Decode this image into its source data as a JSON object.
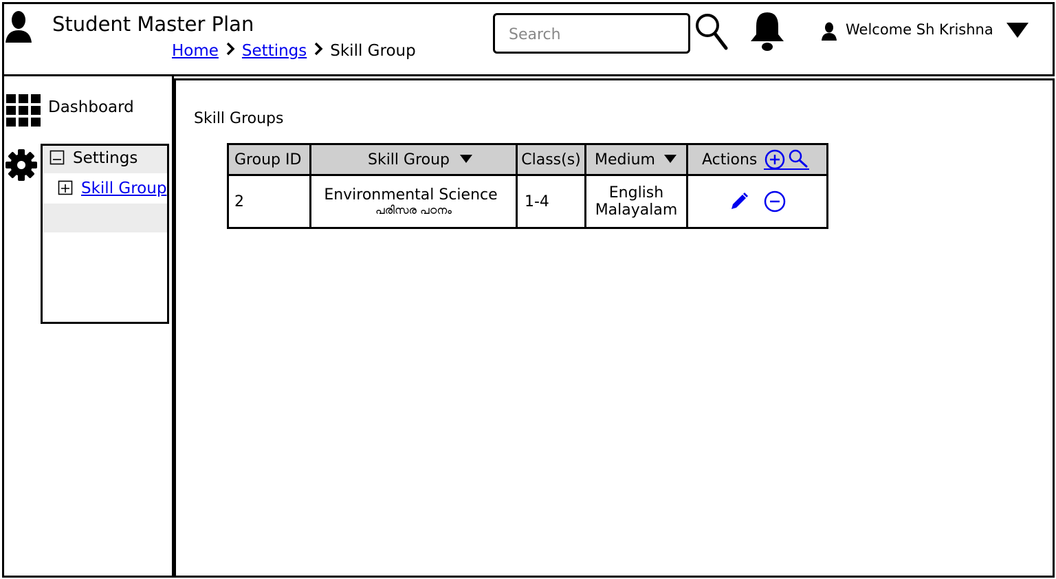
{
  "header": {
    "app_title": "Student Master Plan",
    "breadcrumb": [
      {
        "label": "Home"
      },
      {
        "label": "Settings"
      },
      {
        "label": "Skill Group"
      }
    ],
    "search_placeholder": "Search",
    "welcome": "Welcome Sh Krishna"
  },
  "sidebar": {
    "dashboard_label": "Dashboard",
    "settings_label": "Settings",
    "skill_group_label": "Skill Group"
  },
  "main": {
    "section_title": "Skill Groups",
    "table": {
      "columns": [
        "Group ID",
        "Skill Group",
        "Class(s)",
        "Medium",
        "Actions"
      ],
      "rows": [
        {
          "group_id": "2",
          "skill_group": "Environmental Science",
          "skill_group_ml": "പരിസര പഠനം",
          "classes": "1-4",
          "medium_1": "English",
          "medium_2": "Malayalam"
        }
      ]
    }
  },
  "colors": {
    "link": "#0000ee",
    "header_cell": "#cfcfcf",
    "sidebar_highlight": "#ececec"
  }
}
